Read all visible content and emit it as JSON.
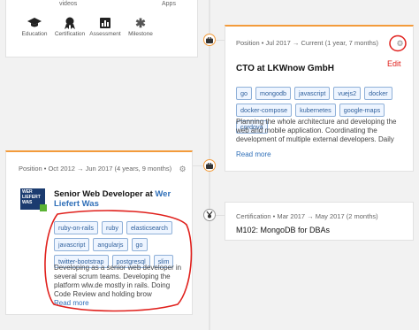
{
  "profile_nav": {
    "top_labels": [
      "videos",
      "Apps"
    ],
    "items": [
      {
        "label": "Education",
        "icon": "graduation-cap-icon"
      },
      {
        "label": "Certification",
        "icon": "badge-icon"
      },
      {
        "label": "Assessment",
        "icon": "bar-chart-icon"
      },
      {
        "label": "Milestone",
        "icon": "milestone-icon"
      }
    ]
  },
  "right_card": {
    "meta": "Position • Jul 2017 → Current (1 year, 7 months)",
    "title": "CTO at LKWnow GmbH",
    "tags": [
      "go",
      "mongodb",
      "javascript",
      "vuejs2",
      "docker",
      "docker-compose",
      "kubernetes",
      "google-maps",
      "cordova"
    ],
    "description": "Planning the whole architecture and developing the web and mobile application. Coordinating the development of multiple external developers. Daily usage of go, MongoDB and JavaScript.",
    "read_more": "Read more",
    "annotation": "Edit"
  },
  "left_card": {
    "meta": "Position • Oct 2012 → Jun 2017 (4 years, 9 months)",
    "title_prefix": "Senior Web Developer at ",
    "company": "Wer Liefert Was",
    "logo_text": [
      "WER",
      "LIEFERT",
      "WAS"
    ],
    "tags": [
      "ruby-on-rails",
      "ruby",
      "elasticsearch",
      "javascript",
      "angularjs",
      "go",
      "twitter-bootstrap",
      "postgresql",
      "slim"
    ],
    "description": "Developing as a senior web developer in several scrum teams. Developing the platform wlw.de mostly in rails. Doing Code Review and holding brow",
    "read_more": "Read more"
  },
  "cert_card": {
    "meta": "Certification • Mar 2017 → May 2017 (2 months)",
    "title": "M102: MongoDB for DBAs"
  },
  "colors": {
    "accent": "#f39b3b",
    "link": "#2f6fb8",
    "annotation": "#e0201c"
  }
}
